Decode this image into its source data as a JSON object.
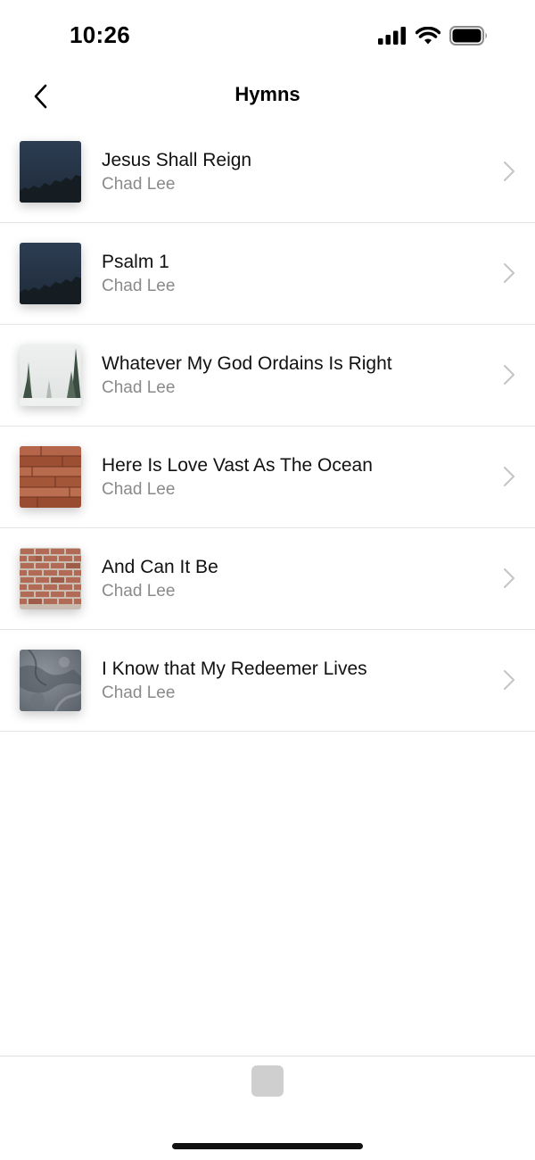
{
  "status_bar": {
    "time": "10:26",
    "icons": [
      "cellular-signal-icon",
      "wifi-icon",
      "battery-icon"
    ]
  },
  "nav": {
    "title": "Hymns",
    "back_icon": "chevron-left-icon"
  },
  "songs": [
    {
      "title": "Jesus Shall Reign",
      "artist": "Chad Lee",
      "artwork": "night-sky-treeline"
    },
    {
      "title": "Psalm 1",
      "artist": "Chad Lee",
      "artwork": "night-sky-treeline"
    },
    {
      "title": "Whatever My God Ordains Is Right",
      "artist": "Chad Lee",
      "artwork": "snowy-forest"
    },
    {
      "title": "Here Is Love Vast As The Ocean",
      "artist": "Chad Lee",
      "artwork": "wood-planks"
    },
    {
      "title": "And Can It Be",
      "artist": "Chad Lee",
      "artwork": "brick-wall"
    },
    {
      "title": "I Know that My Redeemer Lives",
      "artist": "Chad Lee",
      "artwork": "stone-texture"
    }
  ],
  "row_chevron_icon": "chevron-right-icon",
  "bottom_bar": {
    "player_icon": "mini-player-artwork-placeholder"
  },
  "colors": {
    "background": "#ffffff",
    "subtitle_gray": "#8a8a8a",
    "divider": "#e4e4e4",
    "chevron_gray": "#c4c4c4"
  }
}
